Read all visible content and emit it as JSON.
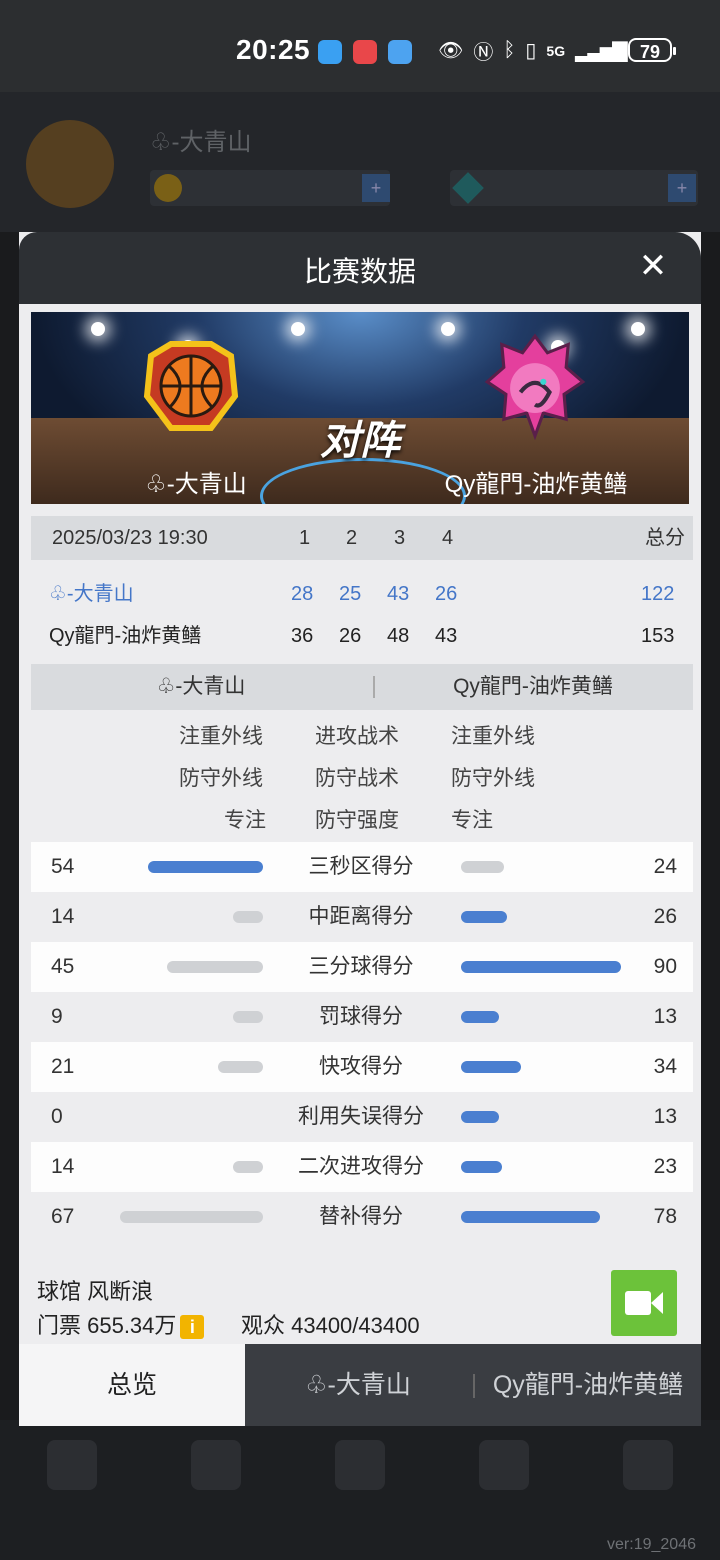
{
  "status_bar": {
    "time": "20:25",
    "battery": "79",
    "network": "5G",
    "app_icons": [
      "blue-app-icon",
      "huawei-app-icon",
      "mail-app-icon"
    ],
    "system_icons": [
      "eye-icon",
      "nfc-icon",
      "bluetooth-icon",
      "vibrate-icon",
      "signal-icon"
    ]
  },
  "background": {
    "version": "ver:19_2046"
  },
  "modal": {
    "title": "比赛数据",
    "vs_label": "对阵",
    "team_left": "♧-大青山",
    "team_right": "Qy龍門-油炸黄鳝"
  },
  "scoreboard": {
    "datetime": "2025/03/23 19:30",
    "quarters": [
      "1",
      "2",
      "3",
      "4"
    ],
    "total_label": "总分",
    "rows": [
      {
        "team": "♧-大青山",
        "q": [
          "28",
          "25",
          "43",
          "26"
        ],
        "total": "122"
      },
      {
        "team": "Qy龍門-油炸黄鳝",
        "q": [
          "36",
          "26",
          "48",
          "43"
        ],
        "total": "153"
      }
    ]
  },
  "tactics": {
    "left_team": "♧-大青山",
    "right_team": "Qy龍門-油炸黄鳝",
    "rows": [
      {
        "left": "注重外线",
        "label": "进攻战术",
        "right": "注重外线"
      },
      {
        "left": "防守外线",
        "label": "防守战术",
        "right": "防守外线"
      },
      {
        "left": "专注",
        "label": "防守强度",
        "right": "专注"
      }
    ]
  },
  "stats": [
    {
      "label": "三秒区得分",
      "left": "54",
      "right": "24",
      "left_lead": true
    },
    {
      "label": "中距离得分",
      "left": "14",
      "right": "26",
      "left_lead": false
    },
    {
      "label": "三分球得分",
      "left": "45",
      "right": "90",
      "left_lead": false
    },
    {
      "label": "罚球得分",
      "left": "9",
      "right": "13",
      "left_lead": false
    },
    {
      "label": "快攻得分",
      "left": "21",
      "right": "34",
      "left_lead": false
    },
    {
      "label": "利用失误得分",
      "left": "0",
      "right": "13",
      "left_lead": false
    },
    {
      "label": "二次进攻得分",
      "left": "14",
      "right": "23",
      "left_lead": false
    },
    {
      "label": "替补得分",
      "left": "67",
      "right": "78",
      "left_lead": false
    }
  ],
  "footer": {
    "venue": "球馆 风断浪",
    "ticket": "门票 655.34万",
    "audience": "观众 43400/43400"
  },
  "tabs": [
    {
      "label": "总览",
      "active": true
    },
    {
      "label": "♧-大青山",
      "active": false
    },
    {
      "label": "Qy龍門-油炸黄鳝",
      "active": false
    }
  ],
  "colors": {
    "accent_blue": "#4a7fd0",
    "bar_gray": "#cfd1d4",
    "video_green": "#6cc23a",
    "info_yellow": "#f2b400"
  }
}
